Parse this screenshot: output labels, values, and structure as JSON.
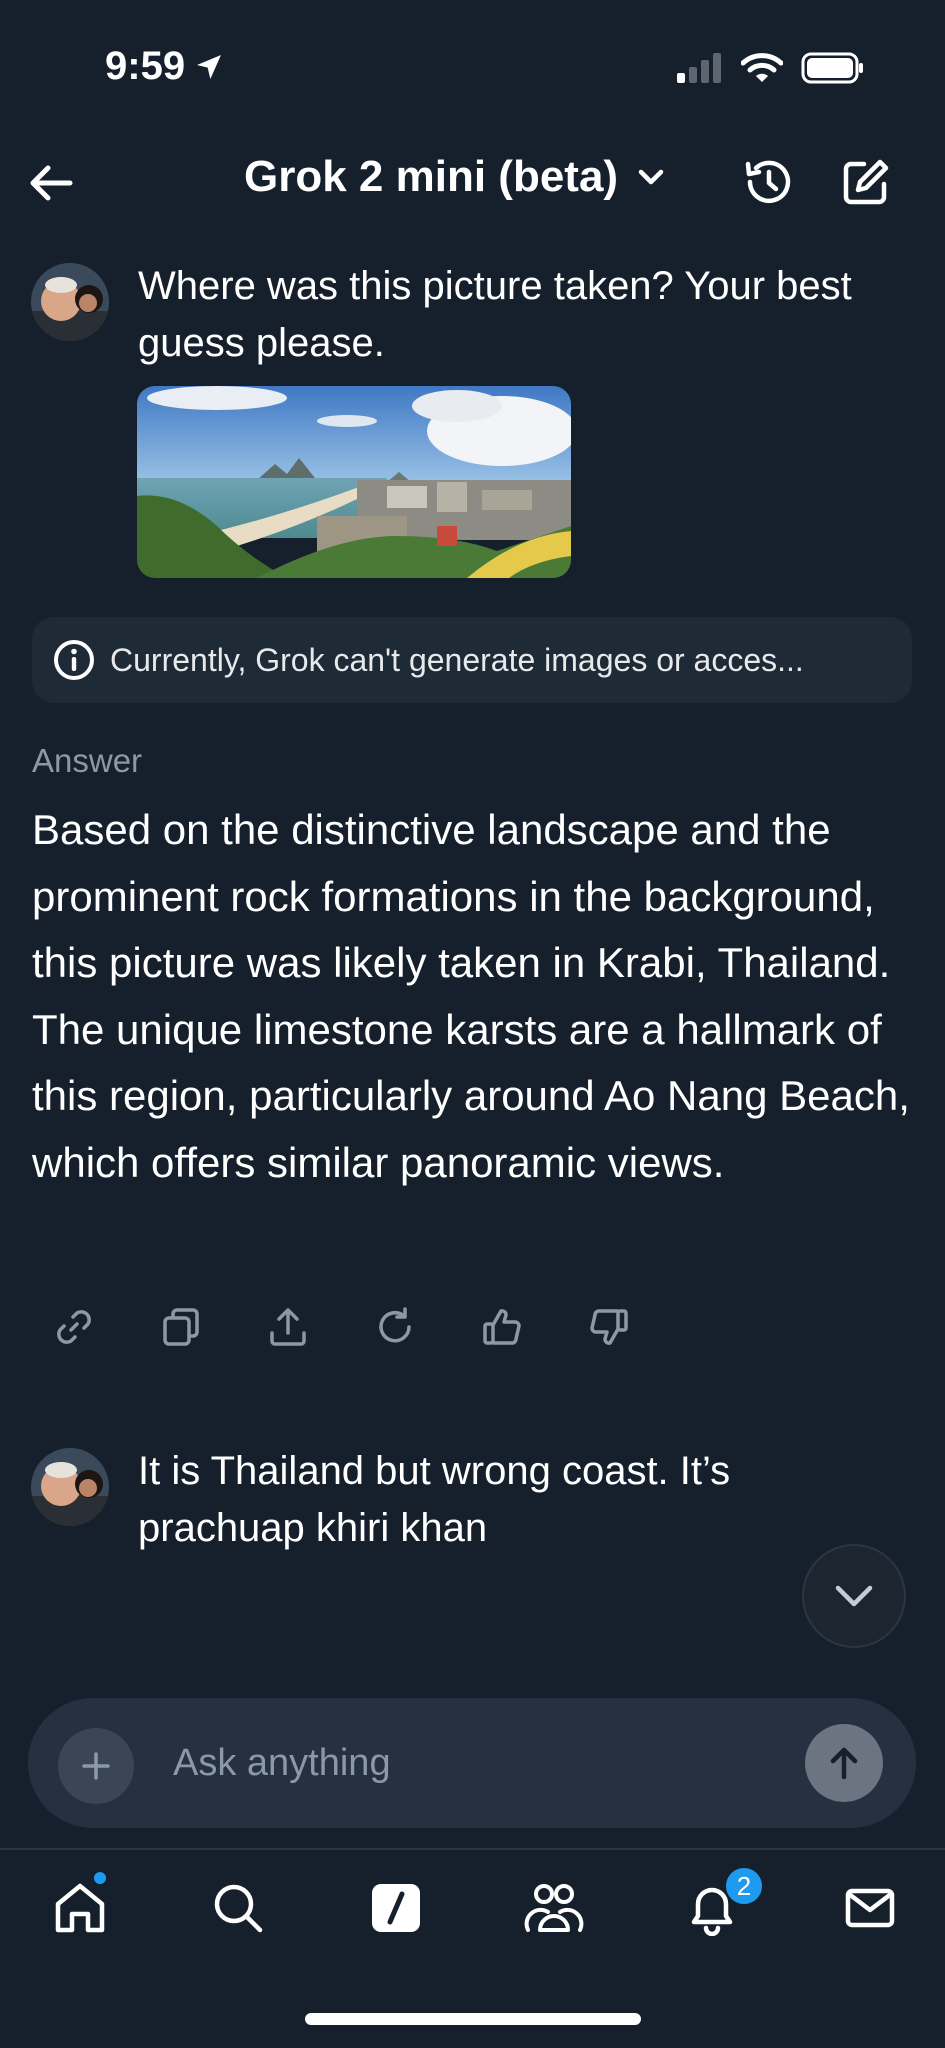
{
  "status_bar": {
    "time": "9:59"
  },
  "header": {
    "title": "Grok 2 mini (beta)"
  },
  "conversation": {
    "user_message_1": "Where was this picture taken? Your best guess please.",
    "notice": "Currently, Grok can't generate images or acces...",
    "answer_label": "Answer",
    "answer": "Based on the distinctive landscape and the prominent rock formations in the background, this picture was likely taken in Krabi, Thailand. The unique limestone karsts are a hallmark of this region, particularly around Ao Nang Beach, which offers similar panoramic views.",
    "user_message_2": "It is Thailand but wrong coast. It’s prachuap khiri khan"
  },
  "composer": {
    "placeholder": "Ask anything"
  },
  "bottom_nav": {
    "notifications_badge": "2"
  },
  "colors": {
    "background": "#16202c",
    "accent": "#1d9bf0",
    "muted_text": "#8b98a5"
  }
}
